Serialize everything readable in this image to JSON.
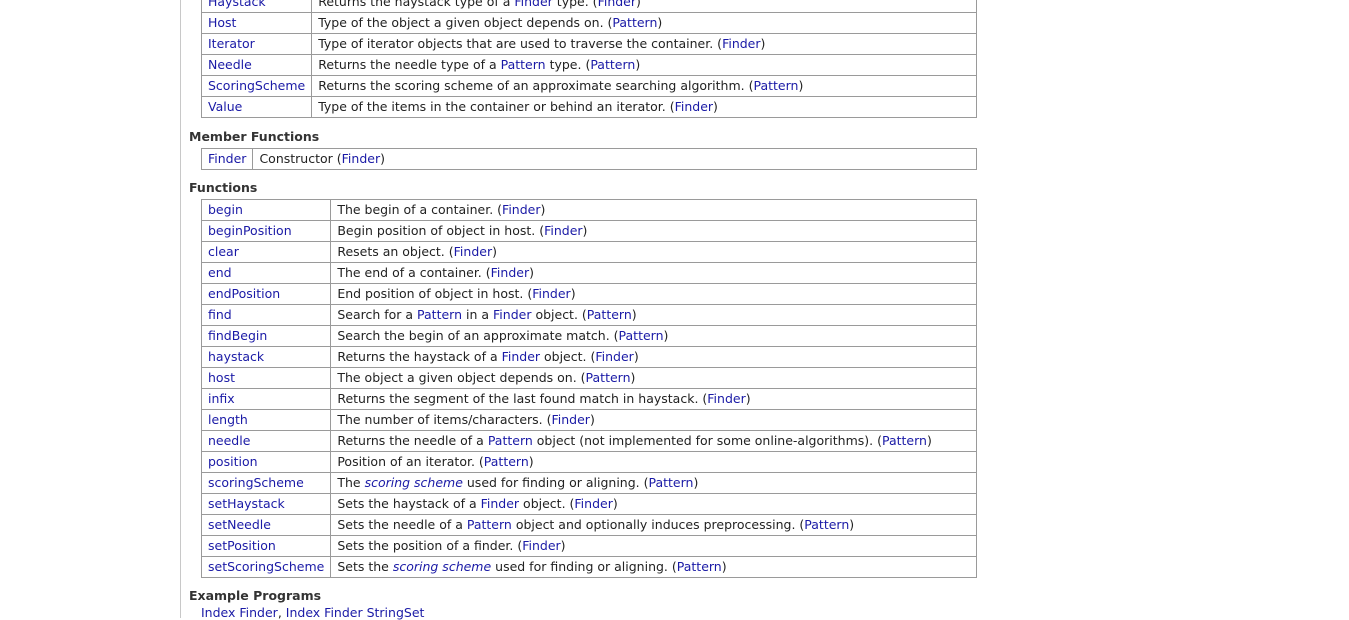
{
  "types": [
    {
      "name": "Haystack",
      "desc": [
        {
          "t": "Returns the haystack type of a "
        },
        {
          "l": "Finder"
        },
        {
          "t": " type. ("
        },
        {
          "l": "Finder"
        },
        {
          "t": ")"
        }
      ]
    },
    {
      "name": "Host",
      "desc": [
        {
          "t": "Type of the object a given object depends on. ("
        },
        {
          "l": "Pattern"
        },
        {
          "t": ")"
        }
      ]
    },
    {
      "name": "Iterator",
      "desc": [
        {
          "t": "Type of iterator objects that are used to traverse the container. ("
        },
        {
          "l": "Finder"
        },
        {
          "t": ")"
        }
      ]
    },
    {
      "name": "Needle",
      "desc": [
        {
          "t": "Returns the needle type of a "
        },
        {
          "l": "Pattern"
        },
        {
          "t": " type. ("
        },
        {
          "l": "Pattern"
        },
        {
          "t": ")"
        }
      ]
    },
    {
      "name": "ScoringScheme",
      "desc": [
        {
          "t": "Returns the scoring scheme of an approximate searching algorithm. ("
        },
        {
          "l": "Pattern"
        },
        {
          "t": ")"
        }
      ]
    },
    {
      "name": "Value",
      "desc": [
        {
          "t": "Type of the items in the container or behind an iterator. ("
        },
        {
          "l": "Finder"
        },
        {
          "t": ")"
        }
      ]
    }
  ],
  "member_functions_title": "Member Functions",
  "member_functions": [
    {
      "name": "Finder",
      "desc": [
        {
          "t": "Constructor ("
        },
        {
          "l": "Finder"
        },
        {
          "t": ")"
        }
      ]
    }
  ],
  "functions_title": "Functions",
  "functions": [
    {
      "name": "begin",
      "desc": [
        {
          "t": "The begin of a container. ("
        },
        {
          "l": "Finder"
        },
        {
          "t": ")"
        }
      ]
    },
    {
      "name": "beginPosition",
      "desc": [
        {
          "t": "Begin position of object in host. ("
        },
        {
          "l": "Finder"
        },
        {
          "t": ")"
        }
      ]
    },
    {
      "name": "clear",
      "desc": [
        {
          "t": "Resets an object. ("
        },
        {
          "l": "Finder"
        },
        {
          "t": ")"
        }
      ]
    },
    {
      "name": "end",
      "desc": [
        {
          "t": "The end of a container. ("
        },
        {
          "l": "Finder"
        },
        {
          "t": ")"
        }
      ]
    },
    {
      "name": "endPosition",
      "desc": [
        {
          "t": "End position of object in host. ("
        },
        {
          "l": "Finder"
        },
        {
          "t": ")"
        }
      ]
    },
    {
      "name": "find",
      "desc": [
        {
          "t": "Search for a "
        },
        {
          "l": "Pattern"
        },
        {
          "t": " in a "
        },
        {
          "l": "Finder"
        },
        {
          "t": " object. ("
        },
        {
          "l": "Pattern"
        },
        {
          "t": ")"
        }
      ]
    },
    {
      "name": "findBegin",
      "desc": [
        {
          "t": "Search the begin of an approximate match. ("
        },
        {
          "l": "Pattern"
        },
        {
          "t": ")"
        }
      ]
    },
    {
      "name": "haystack",
      "desc": [
        {
          "t": "Returns the haystack of a "
        },
        {
          "l": "Finder"
        },
        {
          "t": " object. ("
        },
        {
          "l": "Finder"
        },
        {
          "t": ")"
        }
      ]
    },
    {
      "name": "host",
      "desc": [
        {
          "t": "The object a given object depends on. ("
        },
        {
          "l": "Pattern"
        },
        {
          "t": ")"
        }
      ]
    },
    {
      "name": "infix",
      "desc": [
        {
          "t": "Returns the segment of the last found match in haystack. ("
        },
        {
          "l": "Finder"
        },
        {
          "t": ")"
        }
      ]
    },
    {
      "name": "length",
      "desc": [
        {
          "t": "The number of items/characters. ("
        },
        {
          "l": "Finder"
        },
        {
          "t": ")"
        }
      ]
    },
    {
      "name": "needle",
      "desc": [
        {
          "t": "Returns the needle of a "
        },
        {
          "l": "Pattern"
        },
        {
          "t": " object (not implemented for some online-algorithms). ("
        },
        {
          "l": "Pattern"
        },
        {
          "t": ")"
        }
      ]
    },
    {
      "name": "position",
      "desc": [
        {
          "t": "Position of an iterator. ("
        },
        {
          "l": "Pattern"
        },
        {
          "t": ")"
        }
      ]
    },
    {
      "name": "scoringScheme",
      "desc": [
        {
          "t": "The "
        },
        {
          "li": "scoring scheme"
        },
        {
          "t": " used for finding or aligning. ("
        },
        {
          "l": "Pattern"
        },
        {
          "t": ")"
        }
      ]
    },
    {
      "name": "setHaystack",
      "desc": [
        {
          "t": "Sets the haystack of a "
        },
        {
          "l": "Finder"
        },
        {
          "t": " object. ("
        },
        {
          "l": "Finder"
        },
        {
          "t": ")"
        }
      ]
    },
    {
      "name": "setNeedle",
      "desc": [
        {
          "t": "Sets the needle of a "
        },
        {
          "l": "Pattern"
        },
        {
          "t": " object and optionally induces preprocessing. ("
        },
        {
          "l": "Pattern"
        },
        {
          "t": ")"
        }
      ]
    },
    {
      "name": "setPosition",
      "desc": [
        {
          "t": "Sets the position of a finder. ("
        },
        {
          "l": "Finder"
        },
        {
          "t": ")"
        }
      ]
    },
    {
      "name": "setScoringScheme",
      "desc": [
        {
          "t": "Sets the "
        },
        {
          "li": "scoring scheme"
        },
        {
          "t": " used for finding or aligning. ("
        },
        {
          "l": "Pattern"
        },
        {
          "t": ")"
        }
      ]
    }
  ],
  "examples_title": "Example Programs",
  "examples": {
    "first": "Index Finder",
    "sep": ", ",
    "second": "Index Finder StringSet"
  },
  "colors": {
    "link": "#1a1aa6",
    "border": "#9a9a9a"
  }
}
